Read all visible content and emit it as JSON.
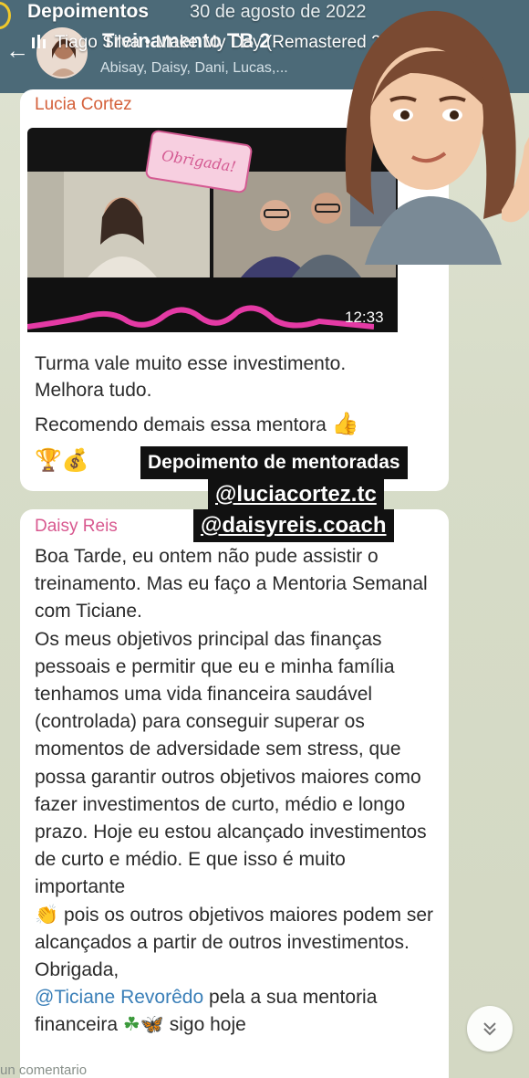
{
  "story": {
    "user": "Depoimentos",
    "date": "30 de agosto de 2022",
    "music": "Tiago Silva • Make My Day (Remastered 2025)"
  },
  "chat": {
    "title": "Treinamento TB 2",
    "members": "Abisay, Daisy, Dani, Lucas,..."
  },
  "message1": {
    "sender": "Lucia Cortez",
    "sticker_text": "Obrigada!",
    "video_duration": "12:33",
    "lines": [
      "Turma vale muito esse investimento.",
      "Melhora tudo."
    ],
    "line3": "Recomendo demais essa mentora",
    "emojis": "🏆💰"
  },
  "overlay": {
    "line1": "Depoimento de mentoradas",
    "line2": "@luciacortez.tc",
    "line3": "@daisyreis.coach"
  },
  "message2": {
    "sender": "Daisy Reis",
    "text_a": "Boa Tarde, eu ontem não pude assistir o treinamento. Mas eu faço a Mentoria Semanal com Ticiane.",
    "text_b": "Os meus objetivos principal das finanças pessoais e permitir que eu e minha família tenhamos uma vida financeira saudável (controlada) para conseguir superar os momentos de adversidade sem stress, que possa garantir outros objetivos maiores como fazer investimentos de curto, médio e longo prazo. Hoje eu estou alcançado investimentos de curto e médio. E que isso é muito importante",
    "text_c": " pois os outros objetivos maiores podem ser alcançados a partir  de outros investimentos. Obrigada,",
    "mention": "@Ticiane Revorêdo",
    "text_d": " pela a sua mentoria financeira",
    "text_e": " sigo hoje",
    "emoji_clap": "👏",
    "emoji_clover": "☘",
    "emoji_butterfly": "🦋"
  },
  "footer": {
    "comment_hint": "un comentario"
  },
  "colors": {
    "header": "#4c6a78",
    "sender1": "#d4603a",
    "sender2": "#d8588f",
    "mention": "#3a7fb8"
  }
}
